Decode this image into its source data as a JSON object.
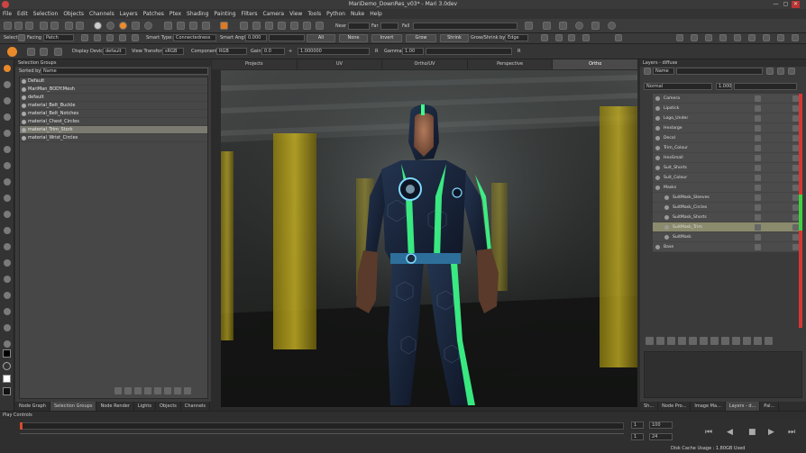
{
  "window": {
    "title": "MariDemo_DownRes_v03* - Mari 3.0dev",
    "min": "—",
    "max": "▢",
    "close": "✕"
  },
  "menu": [
    "File",
    "Edit",
    "Selection",
    "Objects",
    "Channels",
    "Layers",
    "Patches",
    "Ptex",
    "Shading",
    "Painting",
    "Filters",
    "Camera",
    "View",
    "Tools",
    "Python",
    "Nuke",
    "Help"
  ],
  "toolbar_top": {
    "near_label": "Near",
    "far_label": "Far",
    "fall_label": "Fall"
  },
  "toolbar_select": {
    "select_label": "Select",
    "facing_label": "Facing",
    "facing_value": "Patch",
    "smart_type_label": "Smart Type:",
    "smart_type_value": "Connectedness",
    "smart_angle_label": "Smart Angle",
    "smart_angle_value": "0.000",
    "all": "All",
    "none": "None",
    "invert": "Invert",
    "grow": "Grow",
    "shrink": "Shrink",
    "grow_shrink_label": "Grow/Shrink by",
    "grow_shrink_value": "Edge"
  },
  "toolbar_display": {
    "display_device_label": "Display Device",
    "display_device_value": "default",
    "view_transform_label": "View Transform",
    "view_transform_value": "sRGB",
    "component_label": "Component",
    "component_value": "RGB",
    "gain_label": "Gain",
    "gain_value": "0.0",
    "gain_plus": "+",
    "gain_field": "1.000000",
    "r_label": "R",
    "gamma_label": "Gamma",
    "gamma_value": "1.00",
    "r2_label": "R"
  },
  "selection_groups": {
    "title": "Selection Groups",
    "sorted_by_label": "Sorted by",
    "sorted_by_value": "Name",
    "items": [
      "Default",
      "MariMan_BODY:Mesh",
      "default",
      "material_Belt_Buckle",
      "material_Belt_Notches",
      "material_Chest_Circles",
      "material_Trim_Stork",
      "material_Wrist_Circles"
    ],
    "selected_index": 6
  },
  "left_bottom_tabs": [
    "Node Graph",
    "Selection Groups",
    "Node Render",
    "Lights",
    "Objects",
    "Channels"
  ],
  "view_tabs": [
    "Projects",
    "UV",
    "Ortho/UV",
    "Perspective",
    "Ortho"
  ],
  "active_view_tab": 4,
  "layers_panel": {
    "title": "Layers - diffuse",
    "name_label": "Name",
    "blend_mode": "Normal",
    "opacity": "1.000",
    "items": [
      {
        "name": "Camera",
        "indent": 0
      },
      {
        "name": "Lipstick",
        "indent": 0
      },
      {
        "name": "Logo_Under",
        "indent": 0
      },
      {
        "name": "Hexlarge",
        "indent": 0
      },
      {
        "name": "Decal",
        "indent": 0
      },
      {
        "name": "Trim_Colour",
        "indent": 0
      },
      {
        "name": "HexSmall",
        "indent": 0
      },
      {
        "name": "Suit_Shorts",
        "indent": 0
      },
      {
        "name": "Suit_Colour",
        "indent": 0
      },
      {
        "name": "Masks",
        "indent": 0
      },
      {
        "name": "SuitMask_Sleeves",
        "indent": 1
      },
      {
        "name": "SuitMask_Circles",
        "indent": 1
      },
      {
        "name": "SuitMask_Shorts",
        "indent": 1
      },
      {
        "name": "SuitMask_Trim",
        "indent": 1
      },
      {
        "name": "SuitMask",
        "indent": 1
      },
      {
        "name": "Base",
        "indent": 0
      }
    ],
    "selected_index": 13
  },
  "right_bottom_tabs": [
    "Sh...",
    "Node Pro...",
    "Image Ma...",
    "Layers - d...",
    "Pal..."
  ],
  "timeline": {
    "title": "Play Controls",
    "start": "1",
    "current": "100",
    "end": "1",
    "frame": "24",
    "disk_cache": "Disk Cache Usage : 1.80GB Used",
    "field_a": "1",
    "field_b": "100",
    "field_c": "1",
    "field_d": "24"
  },
  "colors": {
    "accent_green": "#3dff8a",
    "suit_blue": "#16213b",
    "highlight": "#f5a623"
  }
}
